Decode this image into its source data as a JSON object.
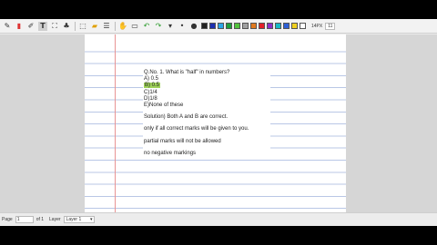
{
  "toolbar": {
    "pen_width_label": "14PX",
    "zoom_value": "11",
    "colors": [
      "#222222",
      "#1e2fb0",
      "#2aa5e6",
      "#1f9e3a",
      "#52c23c",
      "#a0a0a0",
      "#e07a20",
      "#e2202a",
      "#8a2fc9",
      "#17b8c4",
      "#2d5fd6",
      "#f0d020",
      "#ffffff"
    ]
  },
  "document": {
    "question": "Q.No. 1. What is \"half\" in numbers?",
    "options": [
      "A) 0.5",
      "B) 0.5",
      "C)1/4",
      "D)1/8",
      "E)None of these"
    ],
    "solution": "Solution) Both A and B are correct.",
    "note1": "only if all correct marks will be given to you.",
    "note2": "partial marks will not be allowed",
    "note3": "no negative markings"
  },
  "statusbar": {
    "page_label": "Page",
    "page_value": "1",
    "of_label": "of 1",
    "layer_label": "Layer",
    "layer_value": "Layer 1"
  }
}
